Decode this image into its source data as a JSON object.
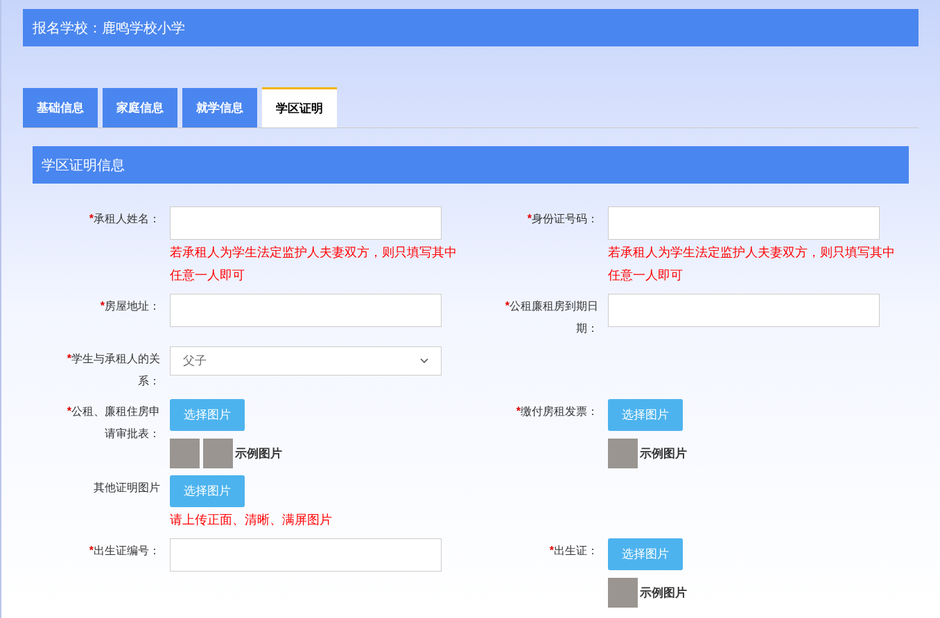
{
  "header": {
    "title": "报名学校：鹿鸣学校小学"
  },
  "tabs": [
    {
      "label": "基础信息",
      "selected": false
    },
    {
      "label": "家庭信息",
      "selected": false
    },
    {
      "label": "就学信息",
      "selected": false
    },
    {
      "label": "学区证明",
      "selected": true
    }
  ],
  "section": {
    "title": "学区证明信息"
  },
  "rows": [
    [
      {
        "kind": "input",
        "required_mark": "*",
        "label": "承租人姓名：",
        "hint": "若承租人为学生法定监护人夫妻双方，则只填写其中任意一人即可"
      },
      {
        "kind": "input",
        "required_mark": "*",
        "label": "身份证号码：",
        "hint": "若承租人为学生法定监护人夫妻双方，则只填写其中任意一人即可"
      }
    ],
    [
      {
        "kind": "input",
        "required_mark": "*",
        "label": "房屋地址："
      },
      {
        "kind": "input",
        "required_mark": "*",
        "label": "公租廉租房到期日期："
      }
    ],
    [
      {
        "kind": "select",
        "required_mark": "*",
        "label": "学生与承租人的关系：",
        "value": "父子"
      }
    ],
    [
      {
        "kind": "upload",
        "required_mark": "*",
        "label": "公租、廉租住房申请审批表：",
        "button": "选择图片",
        "samples": [
          {
            "kind": "photo"
          },
          {
            "kind": "photo"
          }
        ],
        "sample_label": "示例图片"
      },
      {
        "kind": "upload",
        "required_mark": "*",
        "label": "缴付房租发票：",
        "button": "选择图片",
        "samples": [
          {
            "kind": "photo"
          }
        ],
        "sample_label": "示例图片"
      }
    ],
    [
      {
        "kind": "upload",
        "label": "其他证明图片",
        "button": "选择图片",
        "hint": "请上传正面、清晰、满屏图片"
      }
    ],
    [
      {
        "kind": "input",
        "required_mark": "*",
        "label": "出生证编号："
      },
      {
        "kind": "upload",
        "required_mark": "*",
        "label": "出生证：",
        "button": "选择图片",
        "samples": [
          {
            "kind": "photo"
          }
        ],
        "sample_label": "示例图片"
      }
    ]
  ]
}
